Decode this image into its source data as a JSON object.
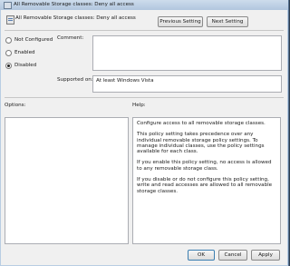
{
  "window": {
    "title": "All Removable Storage classes: Deny all access"
  },
  "header": {
    "policy_title": "All Removable Storage classes: Deny all access",
    "prev_label": "Previous Setting",
    "next_label": "Next Setting"
  },
  "state": {
    "options": [
      {
        "label": "Not Configured",
        "selected": false
      },
      {
        "label": "Enabled",
        "selected": false
      },
      {
        "label": "Disabled",
        "selected": true
      }
    ]
  },
  "comment": {
    "label": "Comment:",
    "value": ""
  },
  "supported": {
    "label": "Supported on:",
    "value": "At least Windows Vista"
  },
  "options_panel": {
    "label": "Options:"
  },
  "help_panel": {
    "label": "Help:",
    "paragraphs": [
      "Configure access to all removable storage classes.",
      "This policy setting takes precedence over any individual removable storage policy settings. To manage individual classes, use the policy settings available for each class.",
      "If you enable this policy setting, no access is allowed to any removable storage class.",
      "If you disable or do not configure this policy setting, write and read accesses are allowed to all removable storage classes."
    ]
  },
  "footer": {
    "ok_label": "OK",
    "cancel_label": "Cancel",
    "apply_label": "Apply"
  }
}
